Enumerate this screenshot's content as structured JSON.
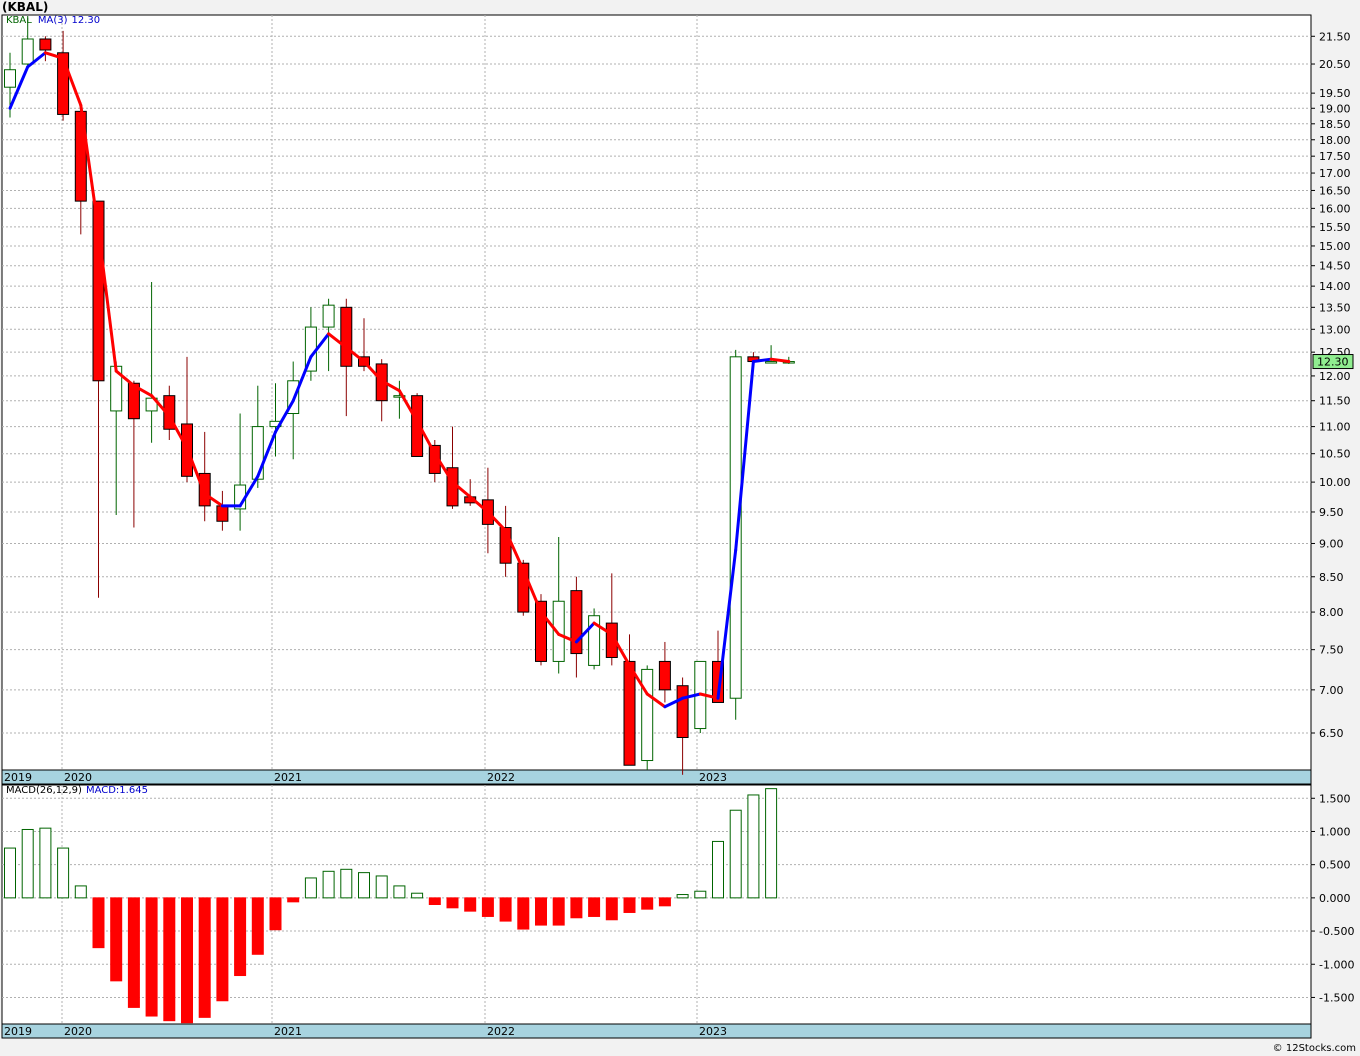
{
  "title": "(KBAL)",
  "price_legend": {
    "symbol": "KBAL",
    "ma_label": "MA(3)",
    "ma_value": "12.30"
  },
  "macd_legend": {
    "label": "MACD(26,12,9)",
    "value_label": "MACD:1.645"
  },
  "last_price_label": "12.30",
  "copyright": "© 12Stocks.com",
  "colors": {
    "up": "#006400",
    "down": "#ff0000",
    "ma_up": "#0000ff",
    "ma_down": "#ff0000",
    "axis_band": "#a7d3df",
    "last_price_box": "#90ee90"
  },
  "chart_data": [
    {
      "type": "candlestick",
      "series": "KBAL monthly",
      "ylim": [
        6.1,
        22.3
      ],
      "y_scale": "log",
      "y_ticks": [
        "6.50",
        "7.00",
        "7.50",
        "8.00",
        "8.50",
        "9.00",
        "9.50",
        "10.00",
        "10.50",
        "11.00",
        "11.50",
        "12.00",
        "12.50",
        "13.00",
        "13.50",
        "14.00",
        "14.50",
        "15.00",
        "15.50",
        "16.00",
        "16.50",
        "17.00",
        "17.50",
        "18.00",
        "18.50",
        "19.00",
        "19.50",
        "20.50",
        "21.50"
      ],
      "x_labels": [
        "2019",
        "2020",
        "2021",
        "2022",
        "2023"
      ],
      "grid": true,
      "candles": [
        {
          "o": 19.7,
          "h": 20.9,
          "l": 18.7,
          "c": 20.3
        },
        {
          "o": 20.5,
          "h": 22.2,
          "l": 20.4,
          "c": 21.4
        },
        {
          "o": 21.4,
          "h": 21.5,
          "l": 20.6,
          "c": 21.0
        },
        {
          "o": 20.9,
          "h": 21.7,
          "l": 18.6,
          "c": 18.8
        },
        {
          "o": 18.9,
          "h": 19.2,
          "l": 15.3,
          "c": 16.2
        },
        {
          "o": 16.2,
          "h": 16.2,
          "l": 8.2,
          "c": 11.9
        },
        {
          "o": 11.3,
          "h": 12.3,
          "l": 9.45,
          "c": 12.2
        },
        {
          "o": 11.85,
          "h": 11.9,
          "l": 9.25,
          "c": 11.15
        },
        {
          "o": 11.3,
          "h": 14.1,
          "l": 10.7,
          "c": 11.55
        },
        {
          "o": 11.6,
          "h": 11.8,
          "l": 10.75,
          "c": 10.95
        },
        {
          "o": 11.05,
          "h": 12.4,
          "l": 10.0,
          "c": 10.1
        },
        {
          "o": 10.15,
          "h": 10.9,
          "l": 9.35,
          "c": 9.6
        },
        {
          "o": 9.6,
          "h": 9.85,
          "l": 9.2,
          "c": 9.35
        },
        {
          "o": 9.55,
          "h": 11.25,
          "l": 9.2,
          "c": 9.95
        },
        {
          "o": 10.05,
          "h": 11.8,
          "l": 9.9,
          "c": 11.0
        },
        {
          "o": 11.0,
          "h": 11.85,
          "l": 10.45,
          "c": 11.1
        },
        {
          "o": 11.25,
          "h": 12.3,
          "l": 10.4,
          "c": 11.9
        },
        {
          "o": 12.1,
          "h": 13.5,
          "l": 11.9,
          "c": 13.05
        },
        {
          "o": 13.05,
          "h": 13.7,
          "l": 12.1,
          "c": 13.55
        },
        {
          "o": 13.5,
          "h": 13.7,
          "l": 11.2,
          "c": 12.2
        },
        {
          "o": 12.4,
          "h": 13.25,
          "l": 12.1,
          "c": 12.2
        },
        {
          "o": 12.25,
          "h": 12.35,
          "l": 11.1,
          "c": 11.5
        },
        {
          "o": 11.6,
          "h": 11.9,
          "l": 11.15,
          "c": 11.6
        },
        {
          "o": 11.6,
          "h": 11.65,
          "l": 10.45,
          "c": 10.45
        },
        {
          "o": 10.65,
          "h": 10.75,
          "l": 10.0,
          "c": 10.15
        },
        {
          "o": 10.25,
          "h": 11.0,
          "l": 9.55,
          "c": 9.6
        },
        {
          "o": 9.75,
          "h": 10.05,
          "l": 9.6,
          "c": 9.65
        },
        {
          "o": 9.7,
          "h": 10.25,
          "l": 8.85,
          "c": 9.3
        },
        {
          "o": 9.25,
          "h": 9.6,
          "l": 8.5,
          "c": 8.7
        },
        {
          "o": 8.7,
          "h": 8.75,
          "l": 7.95,
          "c": 8.0
        },
        {
          "o": 8.15,
          "h": 8.25,
          "l": 7.3,
          "c": 7.35
        },
        {
          "o": 7.35,
          "h": 9.1,
          "l": 7.2,
          "c": 8.15
        },
        {
          "o": 8.3,
          "h": 8.5,
          "l": 7.15,
          "c": 7.45
        },
        {
          "o": 7.3,
          "h": 8.05,
          "l": 7.25,
          "c": 7.95
        },
        {
          "o": 7.85,
          "h": 8.55,
          "l": 7.3,
          "c": 7.4
        },
        {
          "o": 7.35,
          "h": 7.7,
          "l": 6.15,
          "c": 6.15
        },
        {
          "o": 6.2,
          "h": 7.3,
          "l": 6.1,
          "c": 7.25
        },
        {
          "o": 7.35,
          "h": 7.6,
          "l": 6.85,
          "c": 7.0
        },
        {
          "o": 7.05,
          "h": 7.15,
          "l": 6.05,
          "c": 6.45
        },
        {
          "o": 6.55,
          "h": 7.35,
          "l": 6.5,
          "c": 7.35
        },
        {
          "o": 7.35,
          "h": 7.75,
          "l": 6.85,
          "c": 6.85
        },
        {
          "o": 6.9,
          "h": 12.55,
          "l": 6.65,
          "c": 12.4
        },
        {
          "o": 12.4,
          "h": 12.5,
          "l": 12.2,
          "c": 12.3
        },
        {
          "o": 12.3,
          "h": 12.65,
          "l": 12.3,
          "c": 12.3
        },
        {
          "o": 12.3,
          "h": 12.4,
          "l": 12.25,
          "c": 12.3
        }
      ],
      "ma3": [
        19.0,
        20.4,
        20.9,
        20.7,
        19.1,
        15.4,
        12.1,
        11.8,
        11.6,
        11.2,
        10.6,
        9.8,
        9.6,
        9.6,
        10.1,
        10.9,
        11.5,
        12.4,
        12.9,
        12.6,
        12.3,
        11.9,
        11.7,
        11.1,
        10.5,
        10.0,
        9.75,
        9.5,
        9.2,
        8.6,
        8.0,
        7.7,
        7.6,
        7.85,
        7.7,
        7.3,
        6.95,
        6.8,
        6.9,
        6.95,
        6.9,
        8.9,
        12.3,
        12.35,
        12.3
      ]
    },
    {
      "type": "bar",
      "series": "MACD(26,12,9)",
      "ylim": [
        -1.9,
        1.7
      ],
      "y_ticks": [
        "1.500",
        "1.000",
        "0.500",
        "0.000",
        "-0.500",
        "-1.000",
        "-1.500"
      ],
      "x_labels": [
        "2019",
        "2020",
        "2021",
        "2022",
        "2023"
      ],
      "values": [
        0.75,
        1.03,
        1.05,
        0.75,
        0.18,
        -0.75,
        -1.25,
        -1.65,
        -1.78,
        -1.85,
        -1.88,
        -1.8,
        -1.55,
        -1.17,
        -0.85,
        -0.48,
        -0.06,
        0.3,
        0.4,
        0.43,
        0.38,
        0.33,
        0.18,
        0.07,
        -0.1,
        -0.15,
        -0.2,
        -0.28,
        -0.35,
        -0.47,
        -0.41,
        -0.41,
        -0.3,
        -0.28,
        -0.33,
        -0.22,
        -0.17,
        -0.12,
        0.05,
        0.1,
        0.85,
        1.32,
        1.55,
        1.645
      ]
    }
  ]
}
